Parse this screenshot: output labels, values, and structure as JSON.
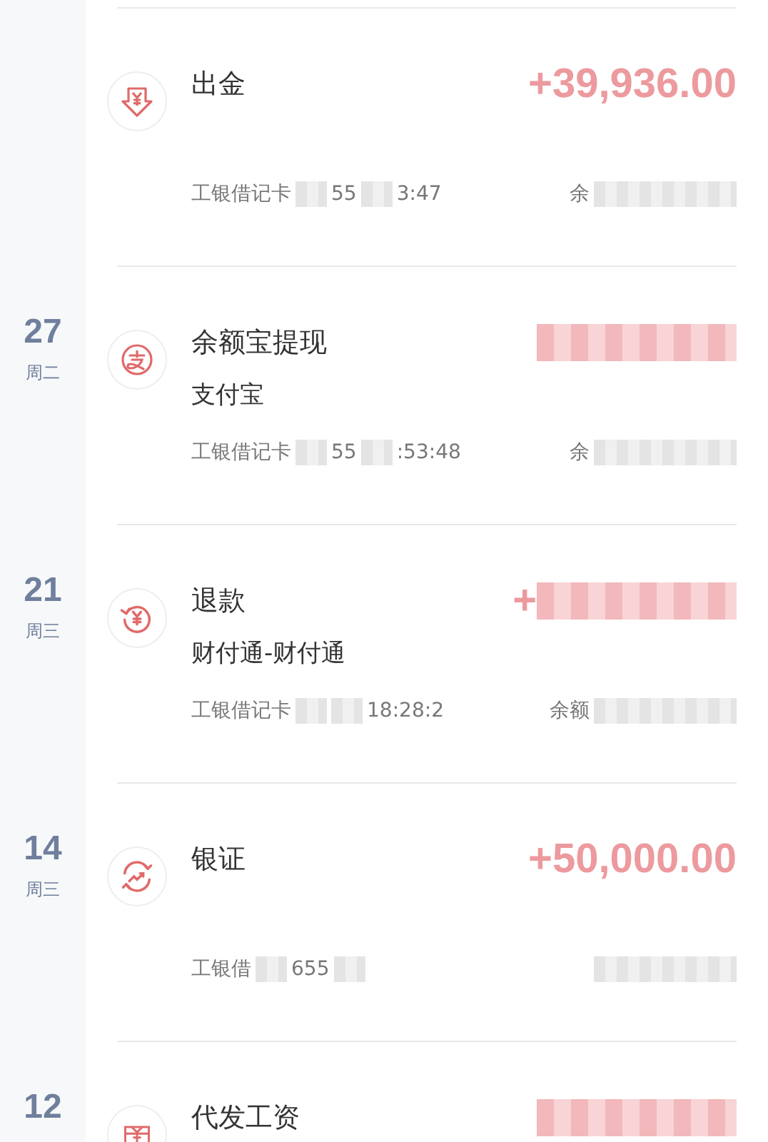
{
  "transactions": [
    {
      "kind": "withdraw",
      "title": "出金",
      "amount": "+39,936.00",
      "amount_blurred": false,
      "meta": {
        "card": "工银借记卡",
        "card_tail": "55",
        "time": "3:47",
        "balance_label": "余"
      }
    },
    {
      "date": {
        "day": "27",
        "weekday": "周二"
      },
      "kind": "wallet",
      "title": "余额宝提现",
      "subtitle": "支付宝",
      "amount_blurred": true,
      "meta": {
        "card": "工银借记卡",
        "card_tail": "55",
        "time": ":53:48",
        "balance_label": "余"
      }
    },
    {
      "date": {
        "day": "21",
        "weekday": "周三"
      },
      "kind": "refund",
      "title": "退款",
      "subtitle": "财付通-财付通",
      "amount": "+",
      "amount_blurred": true,
      "meta": {
        "card": "工银借记卡",
        "time": "18:28:2",
        "balance_label": "余额"
      }
    },
    {
      "date": {
        "day": "14",
        "weekday": "周三"
      },
      "kind": "securities",
      "title": "银证",
      "amount": "+50,000.00",
      "amount_blurred": false,
      "meta": {
        "card": "工银借",
        "card_tail": "655"
      }
    },
    {
      "date": {
        "day": "12"
      },
      "kind": "salary",
      "title": "代发工资",
      "amount_blurred": true
    }
  ]
}
